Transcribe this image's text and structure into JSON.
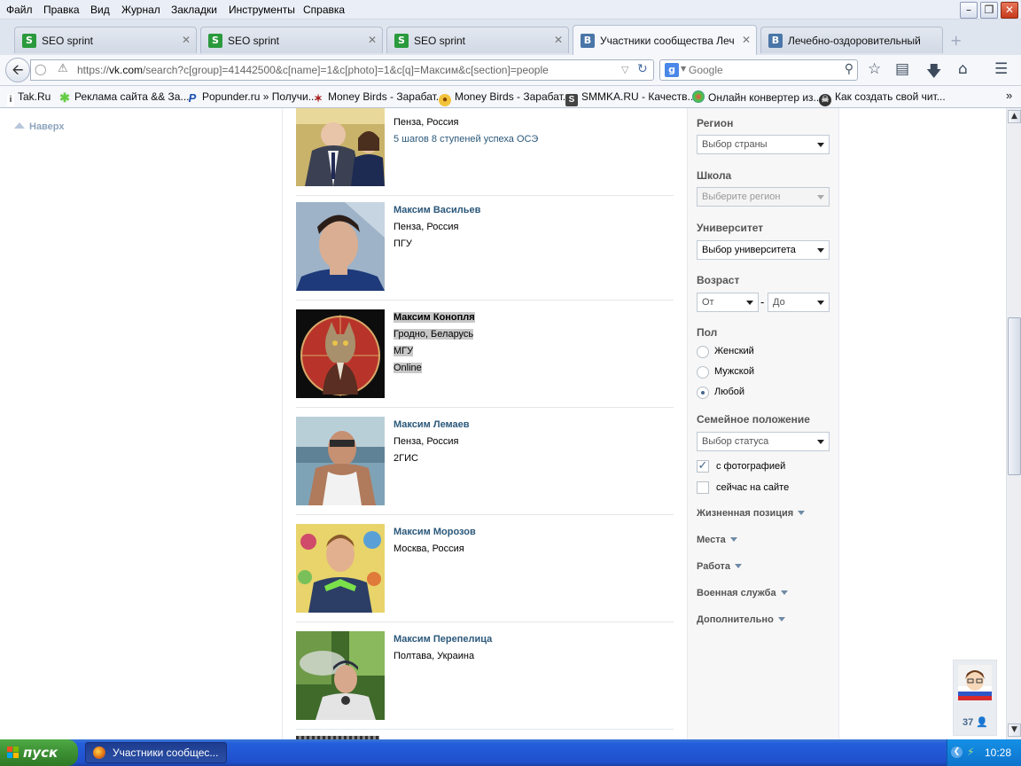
{
  "menu": [
    "Файл",
    "Правка",
    "Вид",
    "Журнал",
    "Закладки",
    "Инструменты",
    "Справка"
  ],
  "tabs": [
    {
      "title": "SEO sprint",
      "icon": "S",
      "active": false
    },
    {
      "title": "SEO sprint",
      "icon": "S",
      "active": false
    },
    {
      "title": "SEO sprint",
      "icon": "S",
      "active": false
    },
    {
      "title": "Участники сообщества Леч...",
      "icon": "B",
      "active": true
    },
    {
      "title": "Лечебно-оздоровительный ц...",
      "icon": "B",
      "active": false
    }
  ],
  "address": {
    "prefix": "https://",
    "domain": "vk.com",
    "path": "/search?c[group]=41442500&c[name]=1&c[photo]=1&c[q]=Максим&c[section]=people"
  },
  "search": {
    "placeholder": "Google"
  },
  "bookmarks": [
    "Tak.Ru",
    "Реклама сайта && За...",
    "Popunder.ru » Получи...",
    "Money Birds - Зарабат...",
    "Money Birds - Зарабат...",
    "SMMKA.RU - Качеств...",
    "Онлайн конвертер из...",
    "Как создать свой чит..."
  ],
  "left": {
    "up_label": "Наверх"
  },
  "people": [
    {
      "name": "",
      "location": "Пенза, Россия",
      "extra": "5 шагов 8 ступеней успеха ОСЭ",
      "extra_is_link": true
    },
    {
      "name": "Максим Васильев",
      "location": "Пенза, Россия",
      "extra": "ПГУ"
    },
    {
      "name": "Максим Конопля",
      "location": "Гродно, Беларусь",
      "extra": "МГУ",
      "status": "Online",
      "highlighted": true
    },
    {
      "name": "Максим Лемаев",
      "location": "Пенза, Россия",
      "extra": "2ГИС"
    },
    {
      "name": "Максим Морозов",
      "location": "Москва, Россия",
      "extra": ""
    },
    {
      "name": "Максим Перепелица",
      "location": "Полтава, Украина",
      "extra": ""
    }
  ],
  "filters": {
    "region_label": "Регион",
    "region_value": "Выбор страны",
    "school_label": "Школа",
    "school_value": "Выберите регион",
    "university_label": "Университет",
    "university_value": "Выбор университета",
    "age_label": "Возраст",
    "age_from": "От",
    "age_sep": "-",
    "age_to": "До",
    "sex_label": "Пол",
    "sex_options": [
      "Женский",
      "Мужской",
      "Любой"
    ],
    "sex_selected": "Любой",
    "marital_label": "Семейное положение",
    "marital_value": "Выбор статуса",
    "with_photo_label": "с фотографией",
    "with_photo_checked": true,
    "online_label": "сейчас на сайте",
    "online_checked": false,
    "expanders": [
      "Жизненная позиция",
      "Места",
      "Работа",
      "Военная служба",
      "Дополнительно"
    ]
  },
  "chat_widget": {
    "count": "37"
  },
  "taskbar": {
    "start": "пуск",
    "window": "Участники сообщес...",
    "clock": "10:28"
  }
}
